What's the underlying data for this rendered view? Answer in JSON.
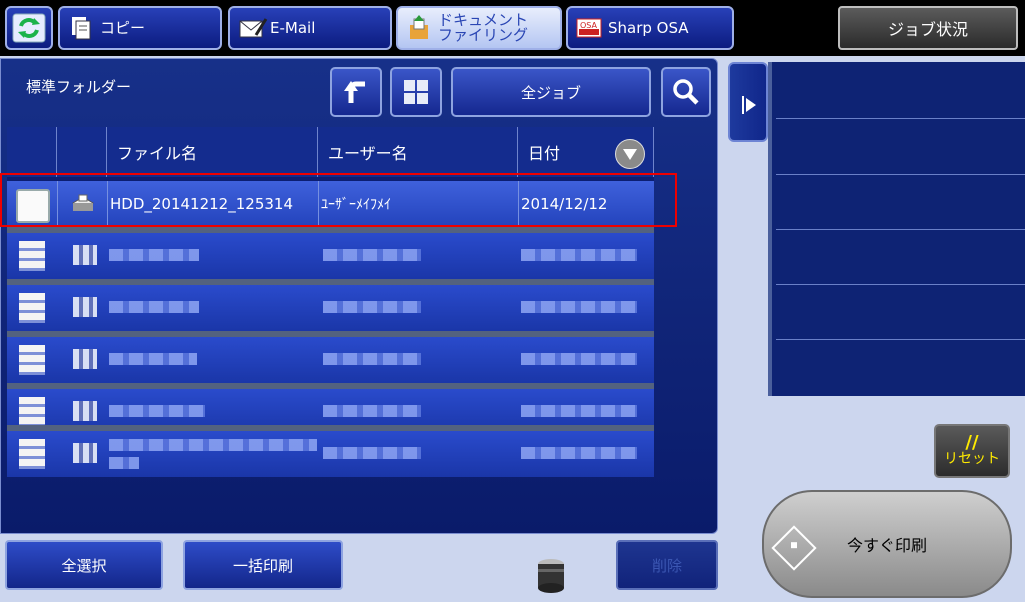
{
  "topbar": {
    "tabs": [
      {
        "id": "copy",
        "label": "コピー",
        "icon": "copy-icon"
      },
      {
        "id": "email",
        "label": "E-Mail",
        "icon": "email-icon"
      },
      {
        "id": "document-filing",
        "label": "ドキュメント\nファイリング",
        "icon": "document-filing-icon"
      },
      {
        "id": "sharp-osa",
        "label": "Sharp OSA",
        "icon": "osa-icon"
      }
    ],
    "job_status_label": "ジョブ状況"
  },
  "main": {
    "folder_title": "標準フォルダー",
    "all_jobs_label": "全ジョブ",
    "table": {
      "headers": [
        "ファイル名",
        "ユーザー名",
        "日付"
      ],
      "selected_row": {
        "file_name": "HDD_20141212_125314",
        "user_name": "ﾕｰｻﾞｰﾒｲﾌﾒｲ",
        "date": "2014/12/12"
      }
    }
  },
  "bottom": {
    "select_all": "全選択",
    "batch_print": "一括印刷",
    "delete": "削除"
  },
  "side": {
    "reset_symbol": "//",
    "reset_label": "リセット",
    "print_now": "今すぐ印刷"
  },
  "colors": {
    "highlight": "#e00000",
    "accent": "#1a36a8",
    "reset_text": "#ffeb00"
  }
}
